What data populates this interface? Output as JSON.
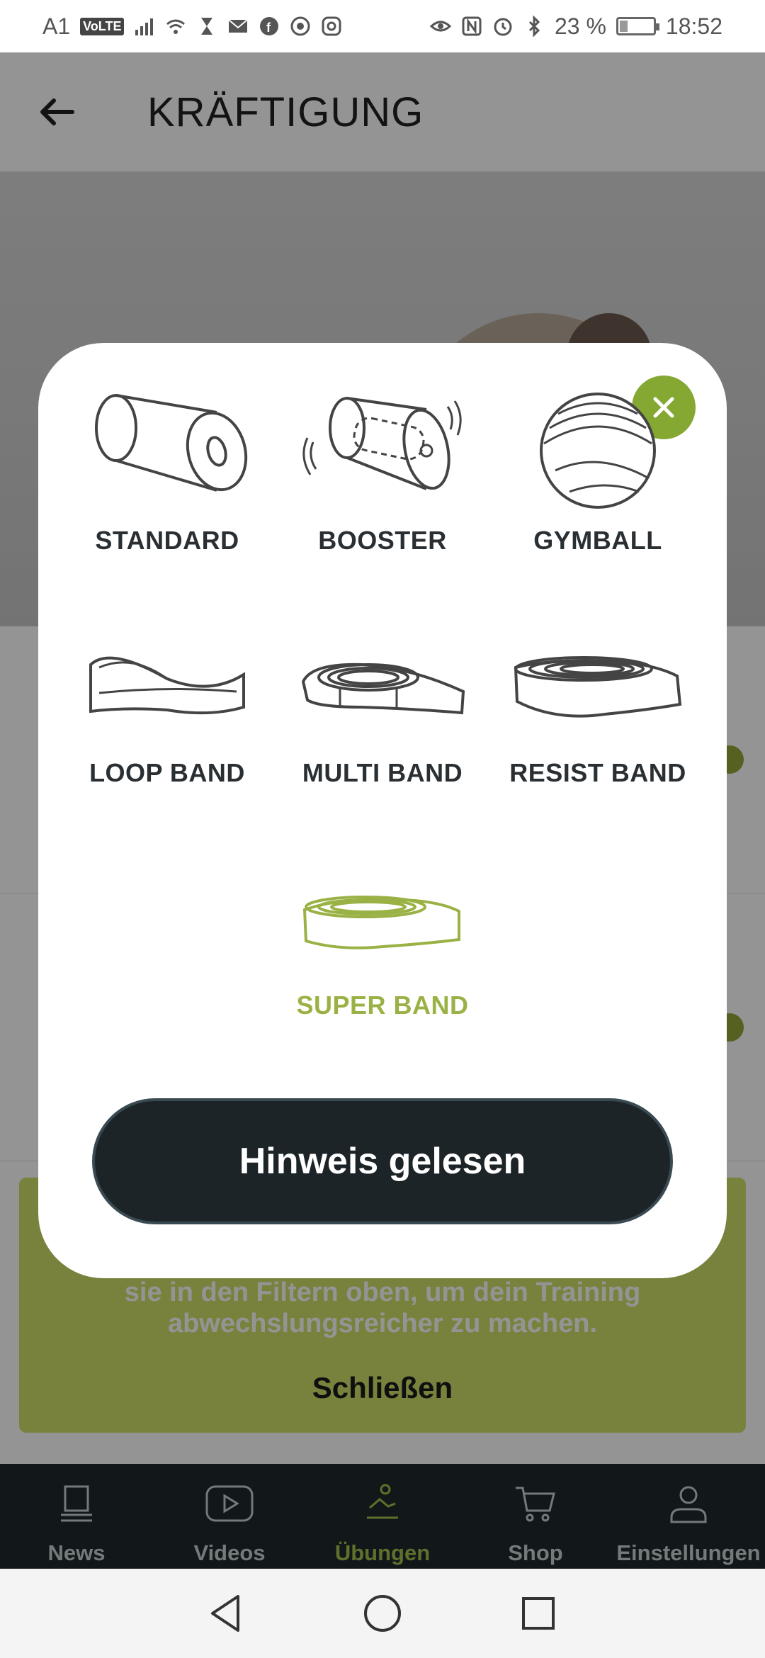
{
  "statusbar": {
    "carrier": "A1",
    "volte": "VoLTE",
    "battery_percent": "23 %",
    "battery_level": 0.23,
    "time": "18:52",
    "icons_left": [
      "signal-icon",
      "wifi-icon",
      "hourglass-icon",
      "mail-icon",
      "facebook-icon",
      "whatsapp-icon",
      "instagram-icon"
    ],
    "icons_right": [
      "eye-icon",
      "nfc-icon",
      "alarm-icon",
      "bluetooth-icon",
      "battery-icon"
    ]
  },
  "appbar": {
    "title": "KRÄFTIGUNG",
    "back_icon": "arrow-left-icon"
  },
  "background": {
    "banner_text_line1": "sie in den Filtern oben, um dein Training",
    "banner_text_line2": "abwechslungsreicher zu machen.",
    "banner_close": "Schließen"
  },
  "modal": {
    "close_icon": "close-icon",
    "accent_color": "#85a833",
    "items": [
      {
        "label": "STANDARD",
        "icon": "foam-roller-icon"
      },
      {
        "label": "BOOSTER",
        "icon": "vibrating-roller-icon"
      },
      {
        "label": "GYMBALL",
        "icon": "gymball-icon"
      },
      {
        "label": "LOOP BAND",
        "icon": "loop-band-icon"
      },
      {
        "label": "MULTI BAND",
        "icon": "multi-band-icon"
      },
      {
        "label": "RESIST BAND",
        "icon": "resist-band-icon"
      },
      {
        "label": "SUPER BAND",
        "icon": "super-band-icon",
        "highlighted": true
      }
    ],
    "ack_button": "Hinweis gelesen"
  },
  "bottomnav": {
    "items": [
      {
        "label": "News",
        "icon": "news-icon"
      },
      {
        "label": "Videos",
        "icon": "video-icon"
      },
      {
        "label": "Übungen",
        "icon": "exercise-icon",
        "active": true
      },
      {
        "label": "Shop",
        "icon": "cart-icon"
      },
      {
        "label": "Einstellungen",
        "icon": "user-icon"
      }
    ],
    "active_color": "#a3c14a"
  },
  "sysnav": {
    "icons": [
      "back-triangle-icon",
      "home-circle-icon",
      "recents-square-icon"
    ]
  }
}
